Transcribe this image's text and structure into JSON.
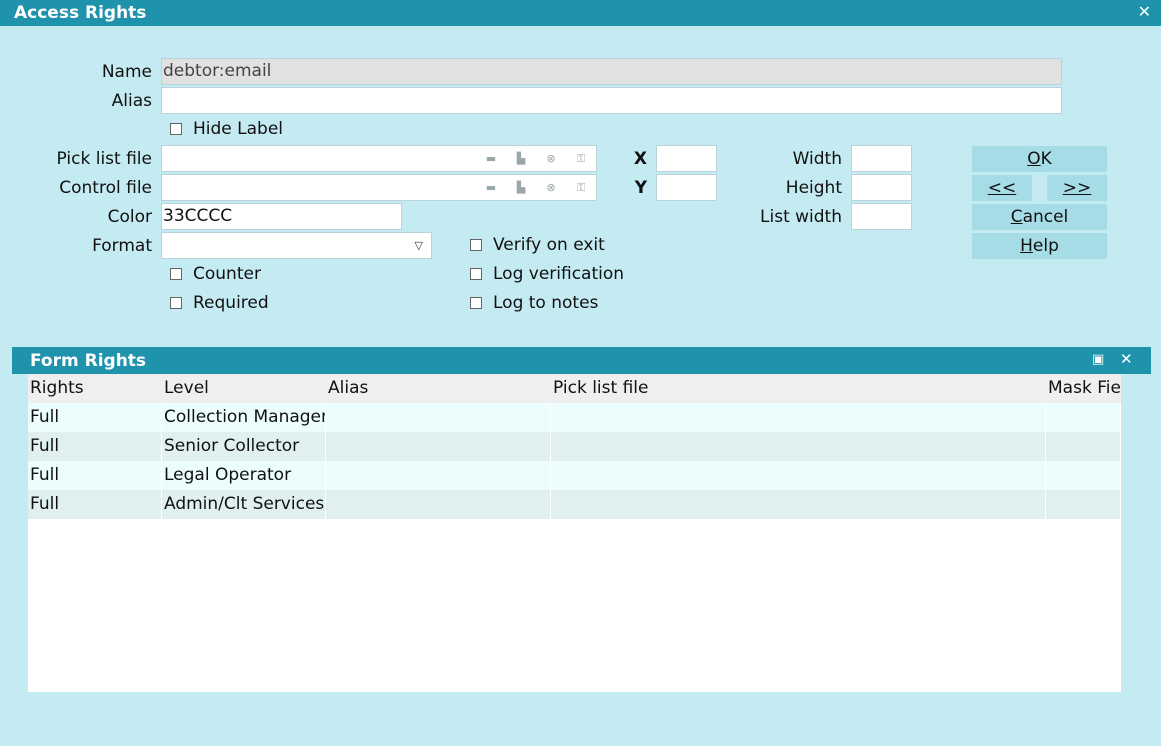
{
  "window": {
    "title": "Access Rights",
    "close_glyph": "✕"
  },
  "form": {
    "name_label": "Name",
    "name_value": "debtor:email",
    "alias_label": "Alias",
    "alias_value": "",
    "hide_label": "Hide Label",
    "picklist_label": "Pick list file",
    "picklist_value": "",
    "control_label": "Control file",
    "control_value": "",
    "color_label": "Color",
    "color_value": "33CCCC",
    "format_label": "Format",
    "format_value": "",
    "x_label": "X",
    "x_value": "",
    "y_label": "Y",
    "y_value": "",
    "width_label": "Width",
    "width_value": "",
    "height_label": "Height",
    "height_value": "",
    "listwidth_label": "List width",
    "listwidth_value": "",
    "verify_label": "Verify on exit",
    "logverify_label": "Log verification",
    "lognotes_label": "Log to notes",
    "counter_label": "Counter",
    "required_label": "Required"
  },
  "field_icons": [
    "folder-open-icon",
    "print-icon",
    "clear-icon",
    "lock-icon"
  ],
  "buttons": {
    "ok_mnemonic": "O",
    "ok_rest": "K",
    "prev": "<<",
    "next": ">>",
    "cancel_mnemonic": "C",
    "cancel_rest": "ancel",
    "help_mnemonic": "H",
    "help_rest": "elp"
  },
  "panel": {
    "title": "Form Rights",
    "maximize_glyph": "▣",
    "close_glyph": "✕"
  },
  "table": {
    "columns": [
      "Rights",
      "Level",
      "Alias",
      "Pick list file",
      "Mask Fie"
    ],
    "rows": [
      [
        "Full",
        "Collection Manager",
        "",
        "",
        ""
      ],
      [
        "Full",
        "Senior Collector",
        "",
        "",
        ""
      ],
      [
        "Full",
        "Legal Operator",
        "",
        "",
        ""
      ],
      [
        "Full",
        "Admin/Clt Services",
        "",
        "",
        ""
      ]
    ]
  },
  "colors": {
    "titlebar": "#1e93ab",
    "background": "#c4eaf2",
    "button": "#a6dce6"
  }
}
